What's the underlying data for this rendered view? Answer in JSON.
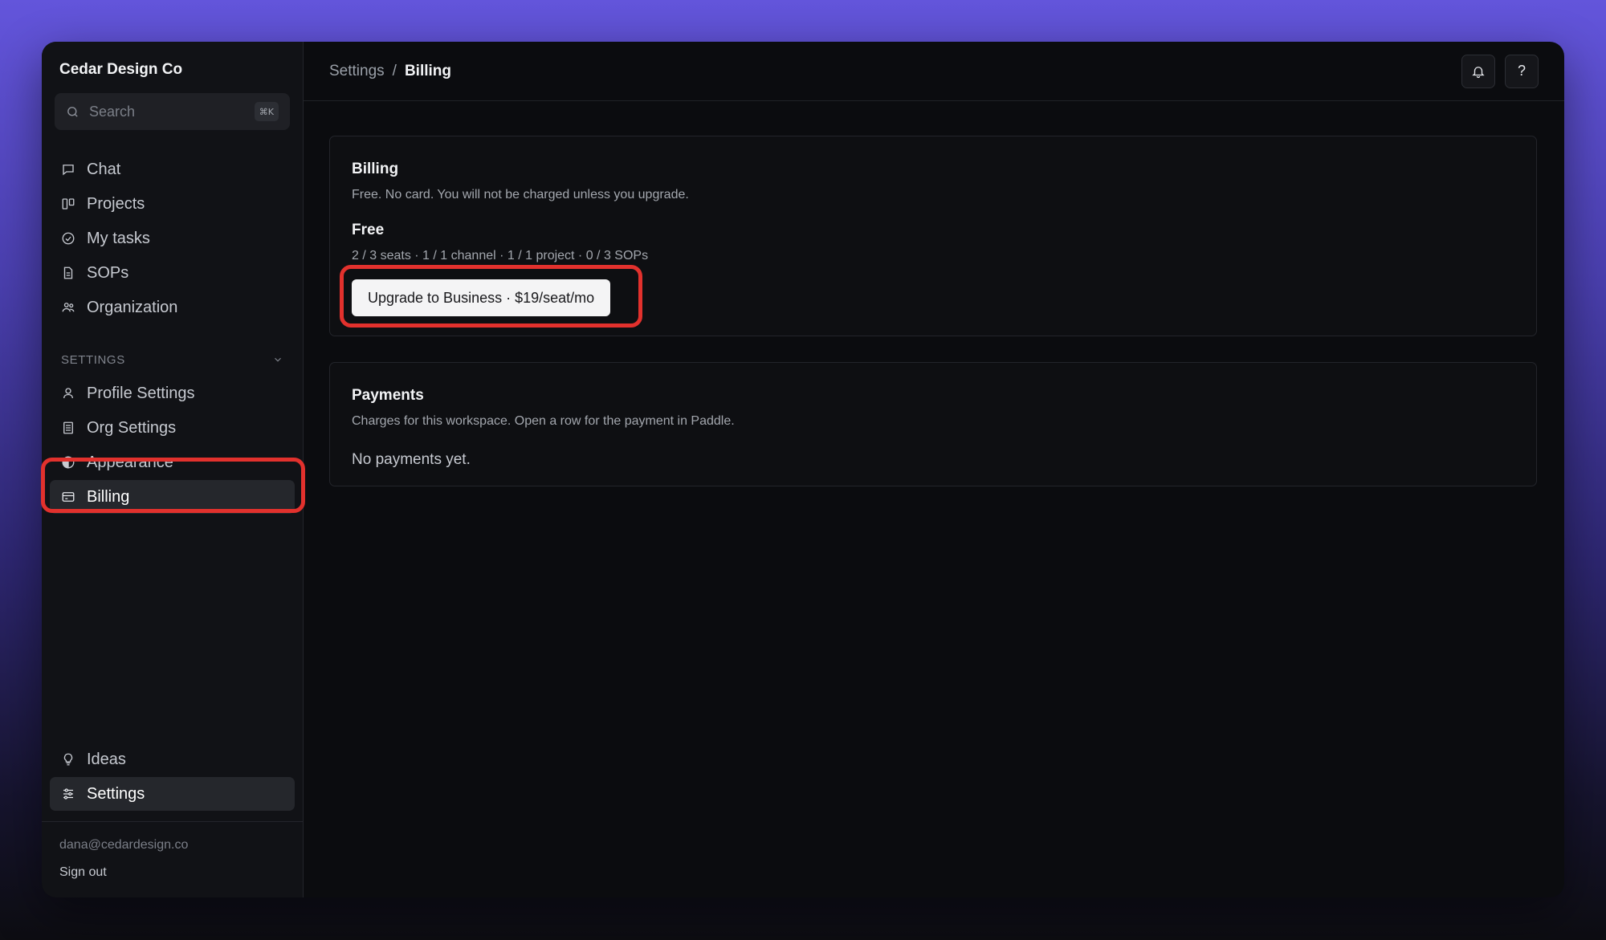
{
  "org": {
    "name": "Cedar Design Co"
  },
  "search": {
    "placeholder": "Search",
    "shortcut": "⌘K"
  },
  "nav": {
    "items": [
      {
        "label": "Chat",
        "icon": "chat-icon"
      },
      {
        "label": "Projects",
        "icon": "board-icon"
      },
      {
        "label": "My tasks",
        "icon": "check-circle-icon"
      },
      {
        "label": "SOPs",
        "icon": "document-icon"
      },
      {
        "label": "Organization",
        "icon": "users-icon"
      }
    ]
  },
  "settings_section": {
    "label": "SETTINGS",
    "items": [
      {
        "label": "Profile Settings",
        "icon": "user-icon"
      },
      {
        "label": "Org Settings",
        "icon": "list-document-icon"
      },
      {
        "label": "Appearance",
        "icon": "half-circle-icon"
      },
      {
        "label": "Billing",
        "icon": "credit-card-icon",
        "active": true
      }
    ]
  },
  "bottom_nav": {
    "items": [
      {
        "label": "Ideas",
        "icon": "lightbulb-icon"
      },
      {
        "label": "Settings",
        "icon": "sliders-icon",
        "active": true
      }
    ]
  },
  "account": {
    "email": "dana@cedardesign.co",
    "sign_out": "Sign out"
  },
  "breadcrumb": {
    "parent": "Settings",
    "separator": "/",
    "current": "Billing"
  },
  "top_actions": {
    "notifications_icon": "bell-icon",
    "help_label": "?"
  },
  "billing_card": {
    "title": "Billing",
    "description": "Free. No card. You will not be charged unless you upgrade.",
    "plan_name": "Free",
    "usage": "2 / 3 seats · 1 / 1 channel · 1 / 1 project · 0 / 3 SOPs",
    "upgrade_label": "Upgrade to Business · $19/seat/mo"
  },
  "payments_card": {
    "title": "Payments",
    "description": "Charges for this workspace. Open a row for the payment in Paddle.",
    "empty": "No payments yet."
  },
  "colors": {
    "highlight": "#e2312d",
    "background_top": "#6355db",
    "window": "#0b0c0f"
  }
}
